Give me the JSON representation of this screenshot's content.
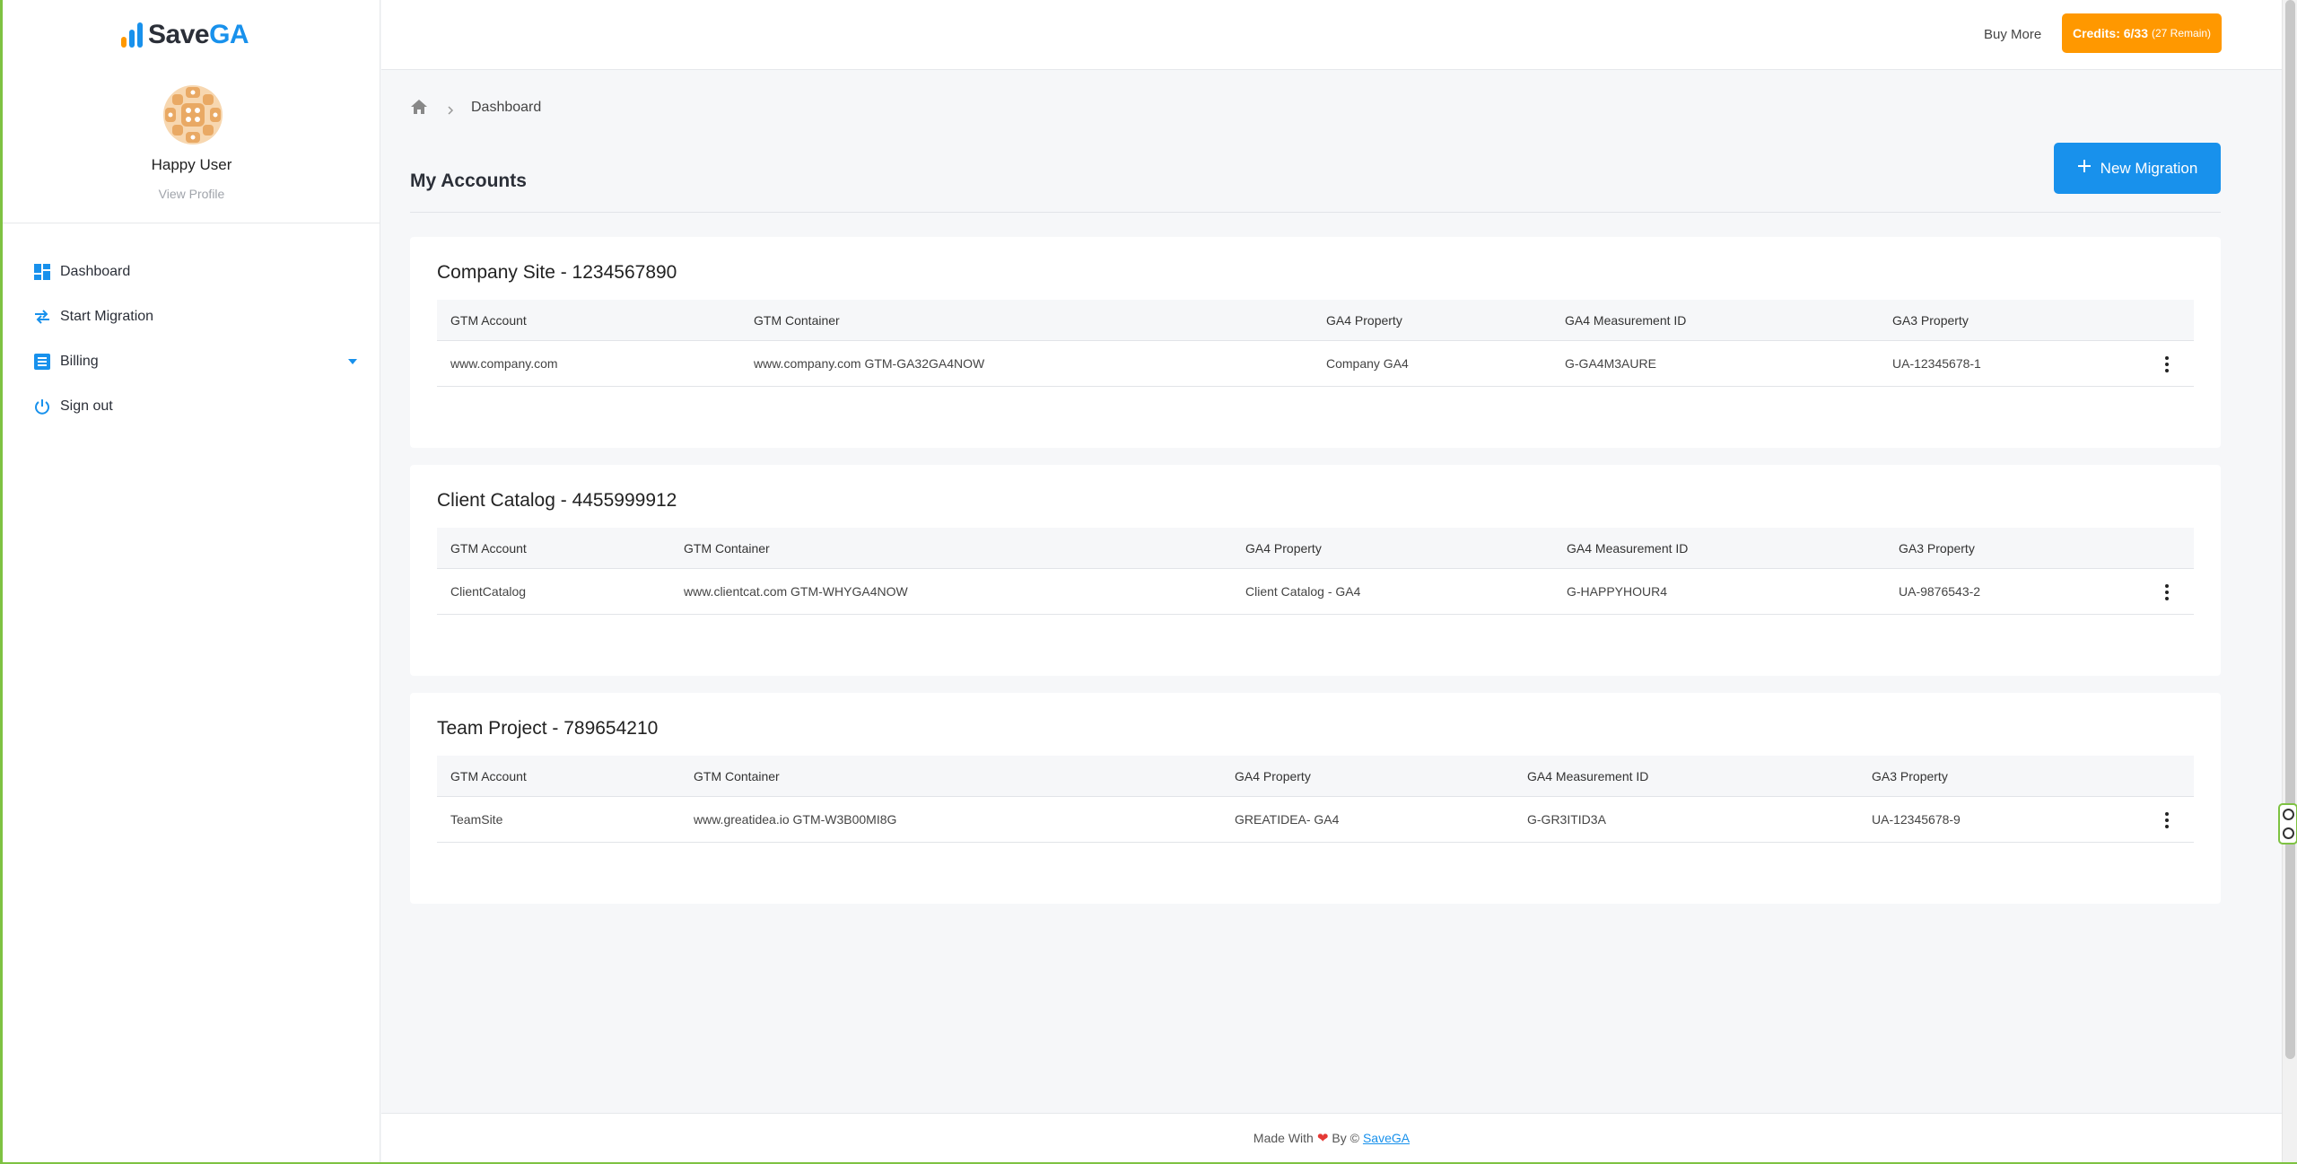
{
  "brand": {
    "logo_text_save": "Save",
    "logo_text_ga": "GA",
    "colors": {
      "accent": "#1891ec",
      "orange": "#ff9800",
      "green": "#7ec242"
    }
  },
  "profile": {
    "name": "Happy User",
    "view_profile": "View Profile"
  },
  "sidebar": {
    "items": [
      {
        "label": "Dashboard",
        "icon": "dashboard-icon"
      },
      {
        "label": "Start Migration",
        "icon": "swap-arrows-icon"
      },
      {
        "label": "Billing",
        "icon": "billing-list-icon"
      },
      {
        "label": "Sign out",
        "icon": "power-icon"
      }
    ]
  },
  "topbar": {
    "buy_more": "Buy More",
    "credits_label": "Credits: 6/33",
    "credits_remain": "(27 Remain)"
  },
  "breadcrumb": {
    "current": "Dashboard"
  },
  "page": {
    "title": "My Accounts",
    "new_migration": "New Migration"
  },
  "accounts": [
    {
      "title": "Company Site - 1234567890",
      "headers": [
        "GTM Account",
        "GTM Container",
        "GA4 Property",
        "GA4 Measurement ID",
        "GA3 Property"
      ],
      "row": [
        "www.company.com",
        "www.company.com GTM-GA32GA4NOW",
        "Company GA4",
        "G-GA4M3AURE",
        "UA-12345678-1"
      ]
    },
    {
      "title": "Client Catalog - 4455999912",
      "headers": [
        "GTM Account",
        "GTM Container",
        "GA4 Property",
        "GA4 Measurement ID",
        "GA3 Property"
      ],
      "row": [
        "ClientCatalog",
        "www.clientcat.com GTM-WHYGA4NOW",
        "Client Catalog - GA4",
        "G-HAPPYHOUR4",
        "UA-9876543-2"
      ]
    },
    {
      "title": "Team Project - 789654210",
      "headers": [
        "GTM Account",
        "GTM Container",
        "GA4 Property",
        "GA4 Measurement ID",
        "GA3 Property"
      ],
      "row": [
        "TeamSite",
        "www.greatidea.io GTM-W3B00MI8G",
        "GREATIDEA- GA4",
        "G-GR3ITID3A",
        "UA-12345678-9"
      ]
    }
  ],
  "footer": {
    "made_with": "Made With",
    "by": "By ©",
    "link": "SaveGA"
  }
}
